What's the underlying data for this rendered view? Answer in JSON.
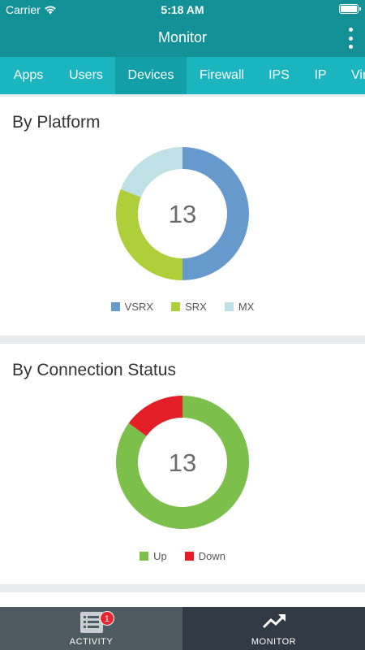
{
  "status_bar": {
    "carrier": "Carrier",
    "time": "5:18 AM"
  },
  "nav": {
    "title": "Monitor"
  },
  "tabs": [
    {
      "label": "Apps",
      "active": false
    },
    {
      "label": "Users",
      "active": false
    },
    {
      "label": "Devices",
      "active": true
    },
    {
      "label": "Firewall",
      "active": false
    },
    {
      "label": "IPS",
      "active": false
    },
    {
      "label": "IP",
      "active": false
    },
    {
      "label": "Vir",
      "active": false
    }
  ],
  "platform_card": {
    "title": "By Platform",
    "total": "13",
    "legend": [
      {
        "label": "VSRX",
        "color": "#6699cc"
      },
      {
        "label": "SRX",
        "color": "#afcf3a"
      },
      {
        "label": "MX",
        "color": "#bfe0e4"
      }
    ]
  },
  "connection_card": {
    "title": "By Connection Status",
    "total": "13",
    "legend": [
      {
        "label": "Up",
        "color": "#7dbf4b"
      },
      {
        "label": "Down",
        "color": "#e41e26"
      }
    ]
  },
  "bottom_tabs": {
    "activity_label": "ACTIVITY",
    "activity_badge": "1",
    "monitor_label": "MONITOR"
  },
  "chart_data": [
    {
      "type": "pie",
      "title": "By Platform",
      "categories": [
        "VSRX",
        "SRX",
        "MX"
      ],
      "values": [
        50,
        31,
        19
      ],
      "center_label": "13"
    },
    {
      "type": "pie",
      "title": "By Connection Status",
      "categories": [
        "Up",
        "Down"
      ],
      "values": [
        85,
        15
      ],
      "center_label": "13"
    }
  ]
}
